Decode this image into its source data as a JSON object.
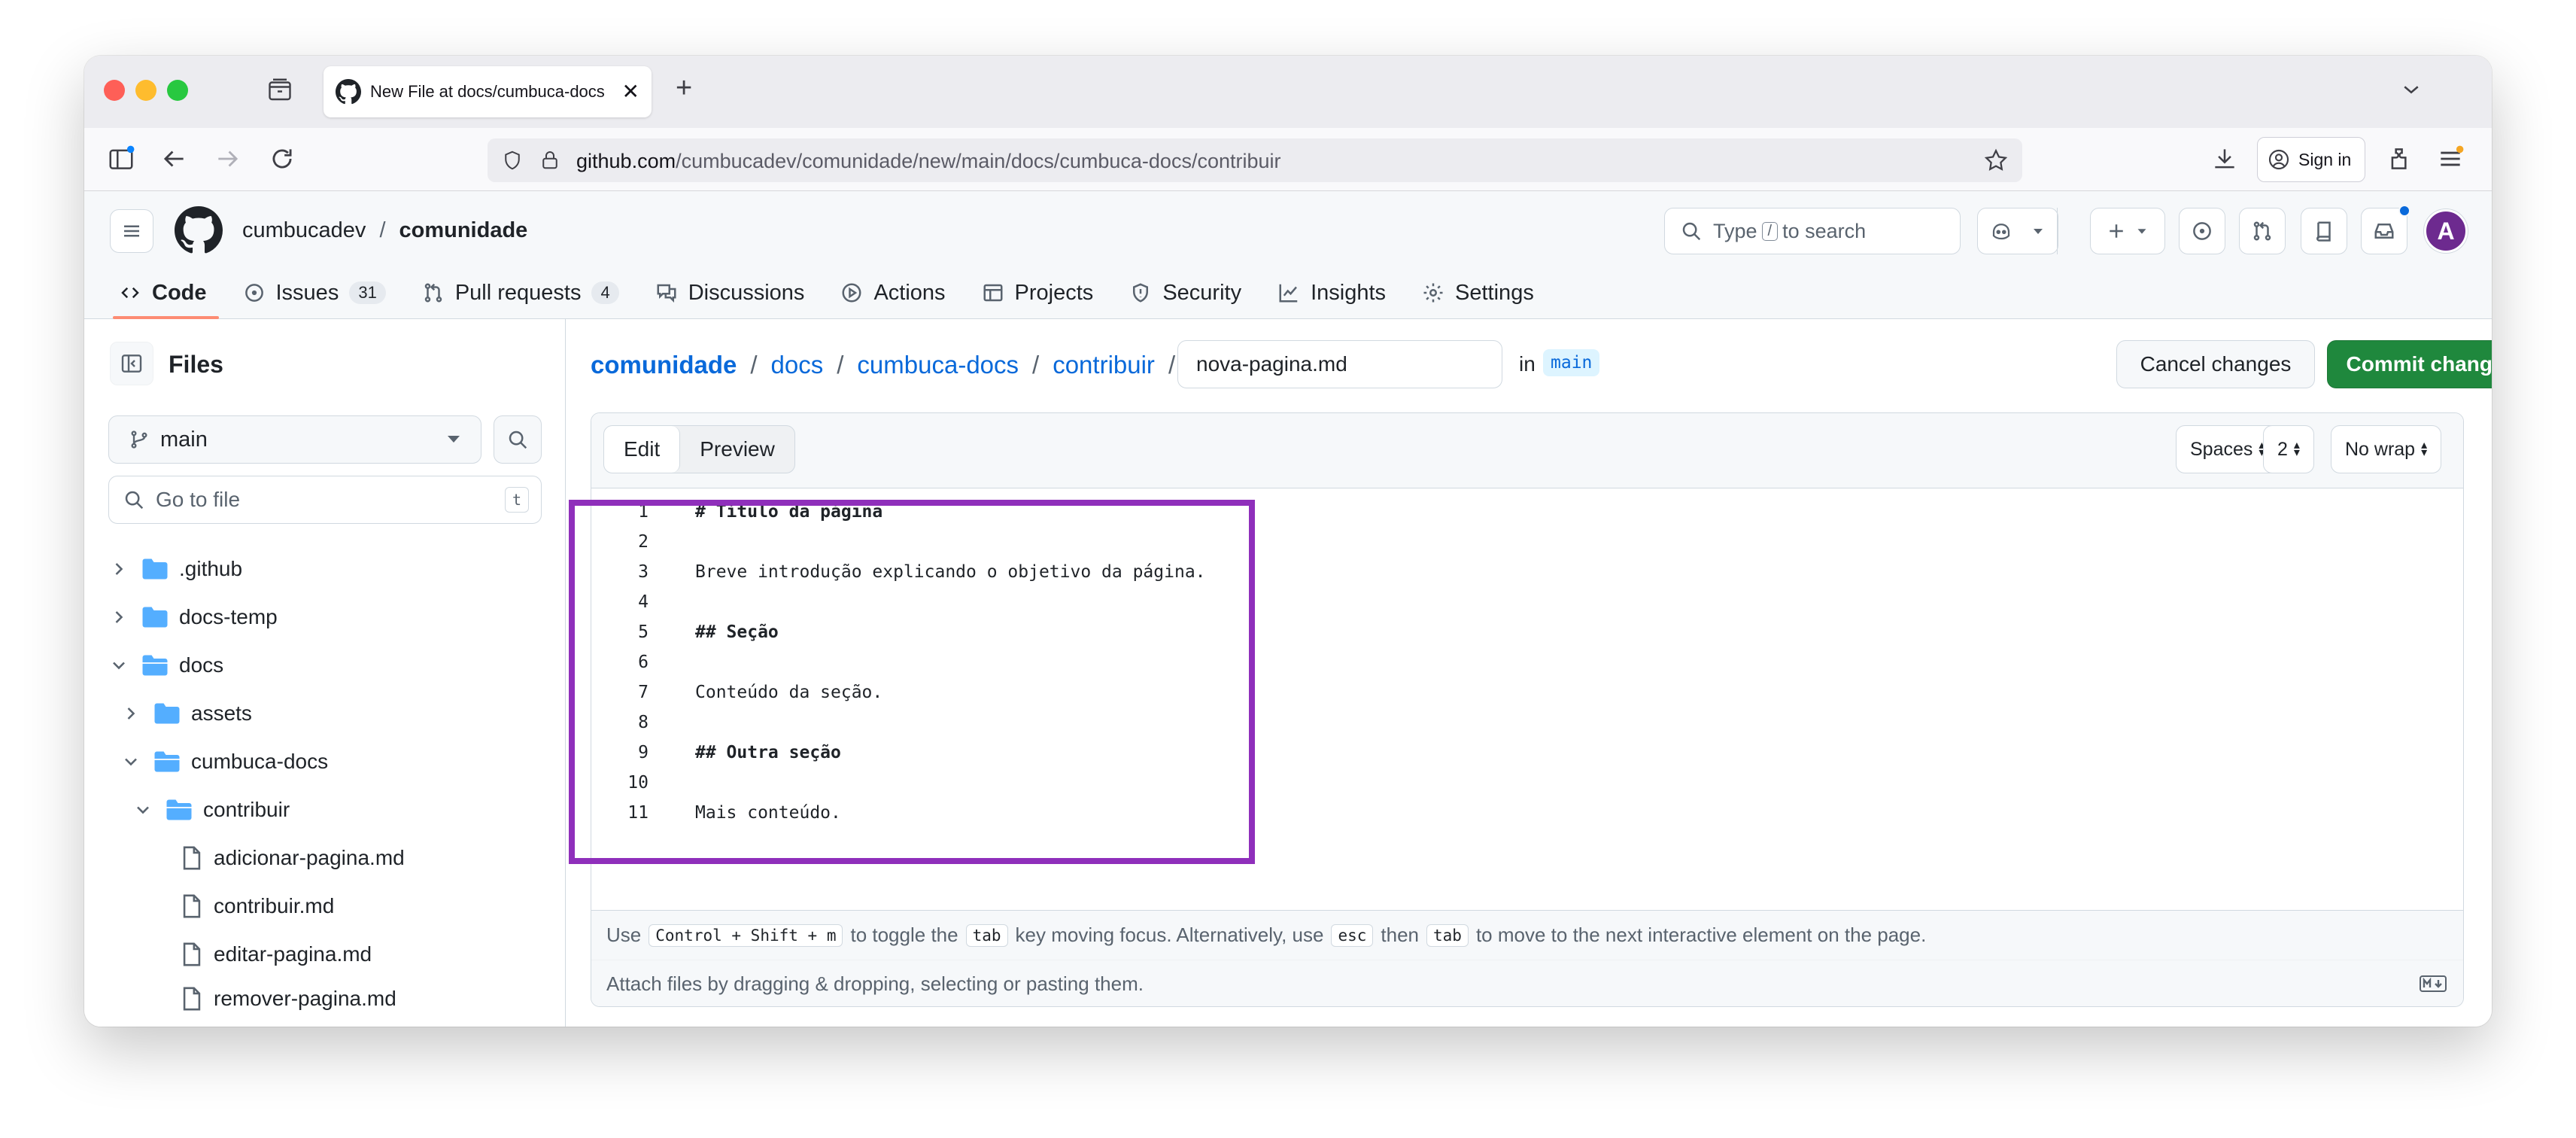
{
  "browser": {
    "tab_title": "New File at docs/cumbuca-docs",
    "url_host": "github.com",
    "url_path": "/cumbucadev/comunidade/new/main/docs/cumbuca-docs/contribuir",
    "sign_in_label": "Sign in"
  },
  "header": {
    "owner": "cumbucadev",
    "separator": "/",
    "repo": "comunidade",
    "search_type": "Type",
    "search_key": "/",
    "search_rest": "to search"
  },
  "repo_nav": {
    "code": "Code",
    "issues": "Issues",
    "issues_count": "31",
    "pulls": "Pull requests",
    "pulls_count": "4",
    "discussions": "Discussions",
    "actions": "Actions",
    "projects": "Projects",
    "security": "Security",
    "insights": "Insights",
    "settings": "Settings"
  },
  "sidebar": {
    "title": "Files",
    "branch": "main",
    "goto_placeholder": "Go to file",
    "goto_shortcut": "t",
    "tree": [
      {
        "label": ".github"
      },
      {
        "label": "docs-temp"
      },
      {
        "label": "docs"
      },
      {
        "label": "assets"
      },
      {
        "label": "cumbuca-docs"
      },
      {
        "label": "contribuir"
      },
      {
        "label": "adicionar-pagina.md"
      },
      {
        "label": "contribuir.md"
      },
      {
        "label": "editar-pagina.md"
      },
      {
        "label": "remover-pagina.md"
      }
    ]
  },
  "editor_page": {
    "crumbs": [
      "comunidade",
      "docs",
      "cumbuca-docs",
      "contribuir"
    ],
    "slash": "/",
    "filename": "nova-pagina.md",
    "in_label": "in",
    "branch_chip": "main",
    "cancel_label": "Cancel changes",
    "commit_label": "Commit changes...",
    "tab_edit": "Edit",
    "tab_preview": "Preview",
    "indent_mode": "Spaces",
    "indent_size": "2",
    "wrap_mode": "No wrap",
    "lines": [
      {
        "n": "1",
        "text": "# Título da página"
      },
      {
        "n": "2",
        "text": ""
      },
      {
        "n": "3",
        "text": "Breve introdução explicando o objetivo da página."
      },
      {
        "n": "4",
        "text": ""
      },
      {
        "n": "5",
        "text": "## Seção"
      },
      {
        "n": "6",
        "text": ""
      },
      {
        "n": "7",
        "text": "Conteúdo da seção."
      },
      {
        "n": "8",
        "text": ""
      },
      {
        "n": "9",
        "text": "## Outra seção"
      },
      {
        "n": "10",
        "text": ""
      },
      {
        "n": "11",
        "text": "Mais conteúdo."
      }
    ],
    "footer": {
      "use": "Use",
      "k1": "Control + Shift + m",
      "t1": "to toggle the",
      "k2": "tab",
      "t2": "key moving focus. Alternatively, use",
      "k3": "esc",
      "t3": "then",
      "k4": "tab",
      "t4": "to move to the next interactive element on the page."
    },
    "attach_text": "Attach files by dragging & dropping, selecting or pasting them."
  },
  "colors": {
    "highlight": "#8f2fbb",
    "commit": "#1f883d",
    "link": "#0969da",
    "folder": "#54aeff"
  }
}
